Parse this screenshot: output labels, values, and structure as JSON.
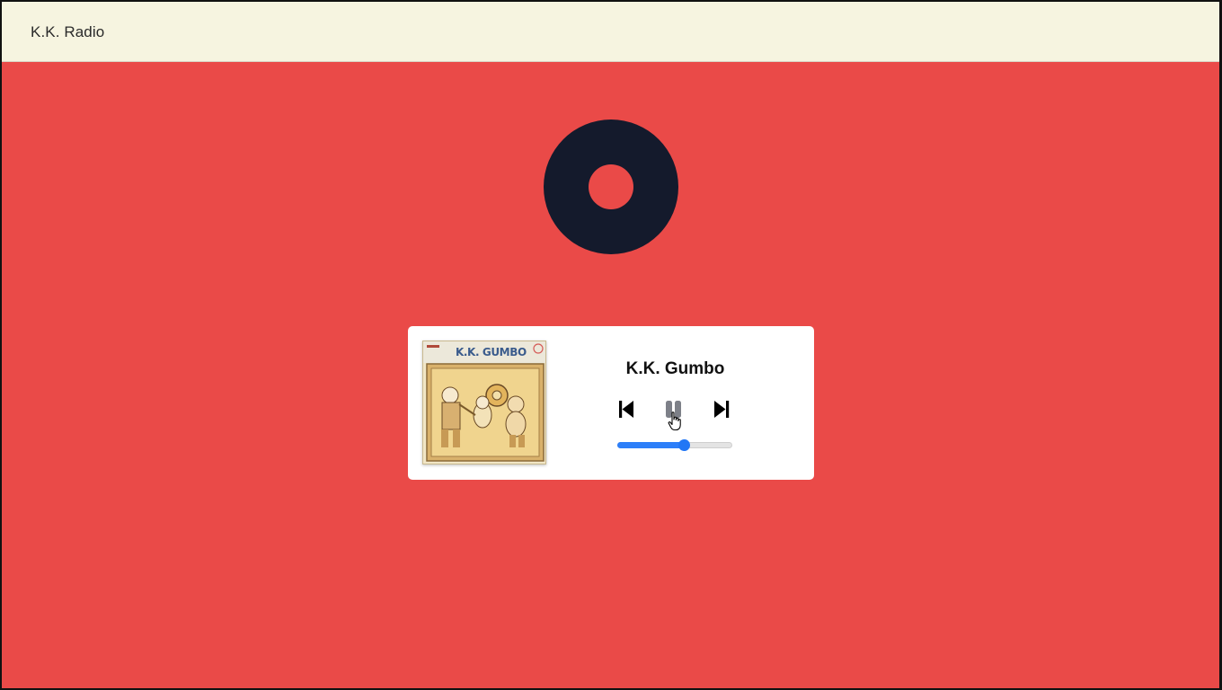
{
  "app": {
    "title": "K.K. Radio"
  },
  "player": {
    "track_title": "K.K. Gumbo",
    "album_cover_title": "K.K. GUMBO",
    "volume": 0.58,
    "state": "playing",
    "controls": {
      "previous_icon": "skip-previous-icon",
      "pause_icon": "pause-icon",
      "next_icon": "skip-next-icon"
    }
  },
  "colors": {
    "background": "#ea4a48",
    "header": "#f6f4e0",
    "vinyl": "#141a2c",
    "accent": "#2d7ff9",
    "card": "#ffffff"
  }
}
